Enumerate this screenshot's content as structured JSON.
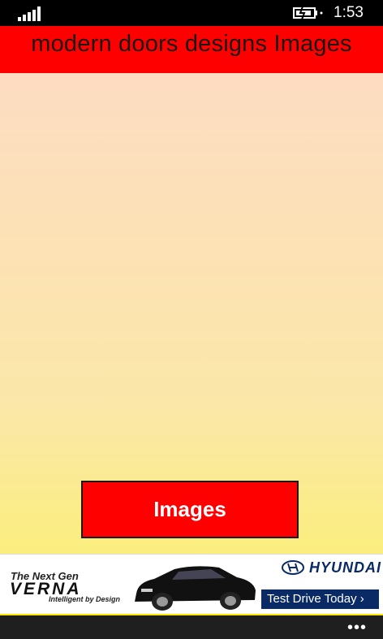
{
  "status_bar": {
    "time": "1:53",
    "signal_icon": "signal-bars-icon",
    "battery_icon": "battery-charging-icon"
  },
  "header": {
    "title": "modern doors designs Images"
  },
  "main": {
    "images_button_label": "Images"
  },
  "ad": {
    "line1": "The Next Gen",
    "model": "VERNA",
    "tagline": "Intelligent by Design",
    "brand": "HYUNDAI",
    "cta": "Test Drive Today ›"
  },
  "app_bar": {
    "more_label": "•••"
  },
  "colors": {
    "title_bar": "#ff0000",
    "button": "#ff0000",
    "gradient_top": "#fddcc2",
    "gradient_bottom": "#fbee7e",
    "ad_blue": "#0a2a66",
    "app_bar_accent": "#ffe600"
  }
}
